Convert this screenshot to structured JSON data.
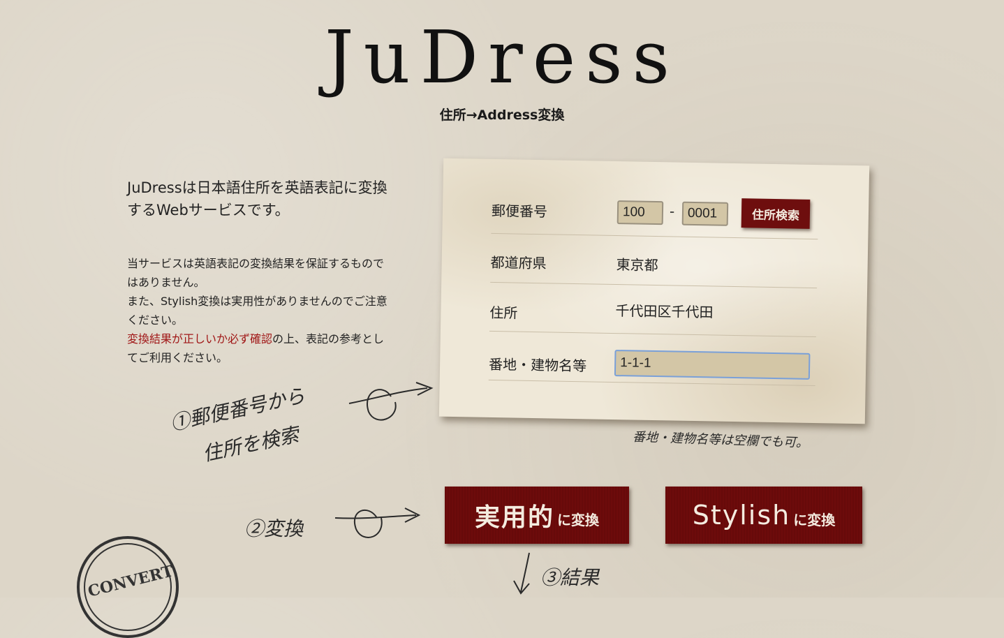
{
  "header": {
    "logo": "JuDress",
    "subtitle": "住所→Address変換"
  },
  "intro": {
    "text": "JuDressは日本語住所を英語表記に変換するWebサービスです。"
  },
  "notice": {
    "line1": "当サービスは英語表記の変換結果を保証するものではありません。",
    "line2": "また、Stylish変換は実用性がありませんのでご注意ください。",
    "warn": "変換結果が正しいか必ず確認",
    "line3": "の上、表記の参考としてご利用ください。"
  },
  "form": {
    "postal_label": "郵便番号",
    "postal1": "100",
    "postal_dash": "-",
    "postal2": "0001",
    "search_button": "住所検索",
    "pref_label": "都道府県",
    "pref_value": "東京都",
    "address_label": "住所",
    "address_value": "千代田区千代田",
    "building_label": "番地・建物名等",
    "building_value": "1-1-1"
  },
  "notes": {
    "step1_line1": "①郵便番号から",
    "step1_line2": "住所を検索",
    "optional": "番地・建物名等は空欄でも可。",
    "step2": "②変換",
    "step3": "③結果"
  },
  "buttons": {
    "practical_main": "実用的",
    "practical_sub": "に変換",
    "stylish_main": "Stylish",
    "stylish_sub": "に変換"
  },
  "stamp": {
    "text": "CONVERT"
  },
  "colors": {
    "background": "#ddd6c8",
    "button": "#6d0b0b",
    "warning": "#a01616",
    "input": "#d3c6a6"
  }
}
